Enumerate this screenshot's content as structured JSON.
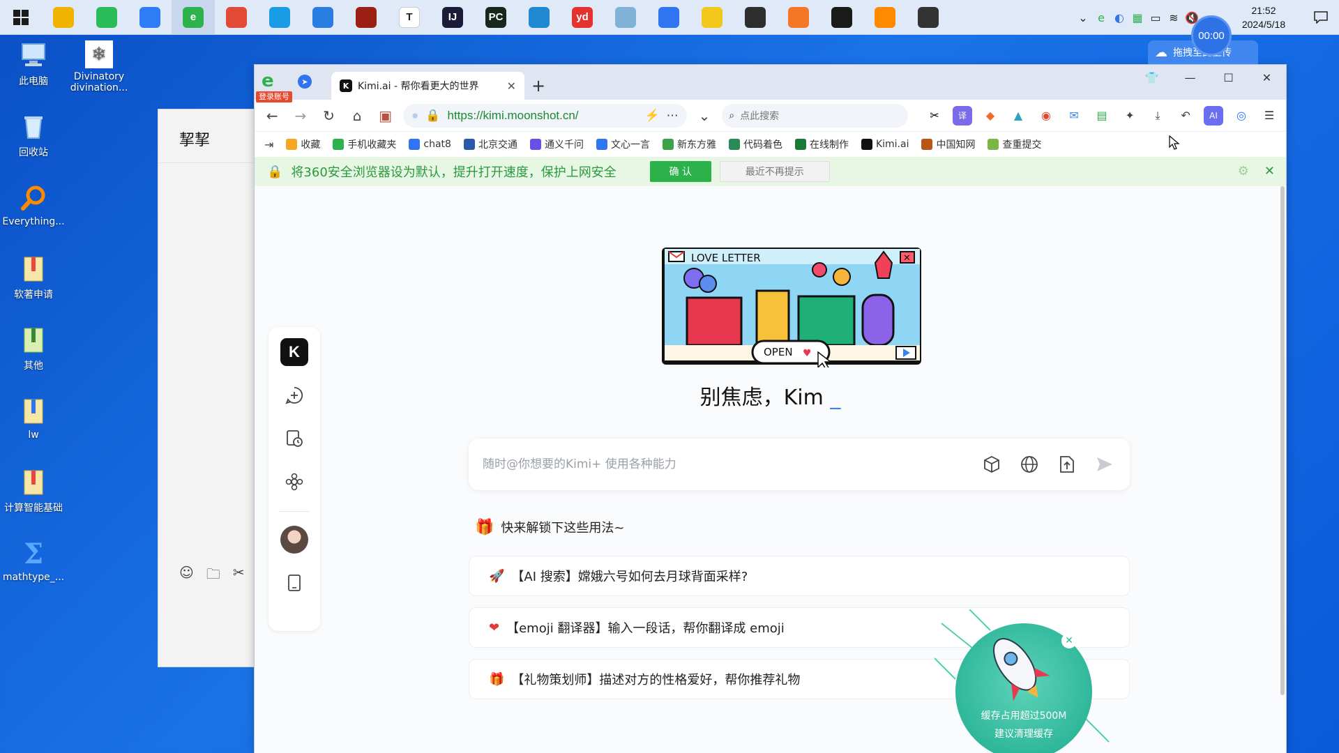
{
  "taskbar": {
    "apps": [
      {
        "name": "file-explorer",
        "glyph": "",
        "color": "#f0b400"
      },
      {
        "name": "wechat",
        "glyph": "",
        "color": "#2bbd5a"
      },
      {
        "name": "feishu",
        "glyph": "",
        "color": "#2f7cf6"
      },
      {
        "name": "360-browser",
        "glyph": "e",
        "color": "#2eb24b"
      },
      {
        "name": "chrome",
        "glyph": "",
        "color": "#e24a35"
      },
      {
        "name": "edge",
        "glyph": "",
        "color": "#1a9be6"
      },
      {
        "name": "photos",
        "glyph": "",
        "color": "#2a7de1"
      },
      {
        "name": "acrobat",
        "glyph": "",
        "color": "#9c1f13"
      },
      {
        "name": "typora",
        "glyph": "T",
        "color": "#ffffff"
      },
      {
        "name": "intellij",
        "glyph": "IJ",
        "color": "#1b1b3a"
      },
      {
        "name": "pycharm",
        "glyph": "PC",
        "color": "#15281b"
      },
      {
        "name": "vscode",
        "glyph": "",
        "color": "#1f8ad2"
      },
      {
        "name": "youdao",
        "glyph": "yd",
        "color": "#e4322f"
      },
      {
        "name": "app-14",
        "glyph": "",
        "color": "#7fb2d6"
      },
      {
        "name": "baidu-netdisk",
        "glyph": "",
        "color": "#2f74f0"
      },
      {
        "name": "app-16",
        "glyph": "",
        "color": "#f2c81c"
      },
      {
        "name": "terminal",
        "glyph": "",
        "color": "#2e2e2e"
      },
      {
        "name": "jupyter",
        "glyph": "",
        "color": "#f37726"
      },
      {
        "name": "mysql-console",
        "glyph": "",
        "color": "#1a1a1a"
      },
      {
        "name": "sublime",
        "glyph": "",
        "color": "#ff8a00"
      },
      {
        "name": "network-app",
        "glyph": "",
        "color": "#333333"
      }
    ],
    "clock_time": "21:52",
    "clock_date": "2024/5/18",
    "timer": "00:00",
    "upload_label": "拖拽至此上传"
  },
  "desktop": {
    "icons": [
      {
        "label": "此电脑"
      },
      {
        "label": "Divinatory divination..."
      },
      {
        "label": "回收站"
      },
      {
        "label": "Everything..."
      },
      {
        "label": "软著申请"
      },
      {
        "label": "其他"
      },
      {
        "label": "lw"
      },
      {
        "label": "计算智能基础"
      },
      {
        "label": "mathtype_..."
      }
    ]
  },
  "chat_window": {
    "title": "挈挈"
  },
  "browser": {
    "login_badge": "登录账号",
    "tab_title": "Kimi.ai - 帮你看更大的世界",
    "url": "https://kimi.moonshot.cn/",
    "search_placeholder": "点此搜索",
    "bookmarks": [
      {
        "label": "收藏",
        "color": "#f5a623"
      },
      {
        "label": "手机收藏夹",
        "color": "#2eb24b"
      },
      {
        "label": "chat8",
        "color": "#2f74f0"
      },
      {
        "label": "北京交通",
        "color": "#2a5aa8"
      },
      {
        "label": "通义千问",
        "color": "#6a4ee8"
      },
      {
        "label": "文心一言",
        "color": "#2f74f0"
      },
      {
        "label": "新东方雅",
        "color": "#3aa34a"
      },
      {
        "label": "代码着色",
        "color": "#2a8a5a"
      },
      {
        "label": "在线制作",
        "color": "#1a7a3a"
      },
      {
        "label": "Kimi.ai",
        "color": "#111111"
      },
      {
        "label": "中国知网",
        "color": "#b8561a"
      },
      {
        "label": "查重提交",
        "color": "#7ab648"
      }
    ],
    "notice": {
      "text": "将360安全浏览器设为默认，提升打开速度，保护上网安全",
      "confirm": "确 认",
      "later": "最近不再提示"
    }
  },
  "kimi": {
    "greeting": "别焦虑，Kim",
    "greeting_cursor": "_",
    "prompt_placeholder": "随时@你想要的Kimi+ 使用各种能力",
    "unlock_heading": "快来解锁下这些用法~",
    "suggestions": [
      {
        "icon": "rocket-icon",
        "text": "【AI 搜索】嫦娥六号如何去月球背面采样?"
      },
      {
        "icon": "heart-icon",
        "text": "【emoji 翻译器】输入一段话，帮你翻译成 emoji"
      },
      {
        "icon": "gift-icon",
        "text": "【礼物策划师】描述对方的性格爱好，帮你推荐礼物"
      }
    ],
    "hero": {
      "love_letter": "LOVE LETTER",
      "open_label": "OPEN"
    }
  },
  "cache_popup": {
    "line1": "缓存占用超过500M",
    "line2": "建议清理缓存"
  }
}
